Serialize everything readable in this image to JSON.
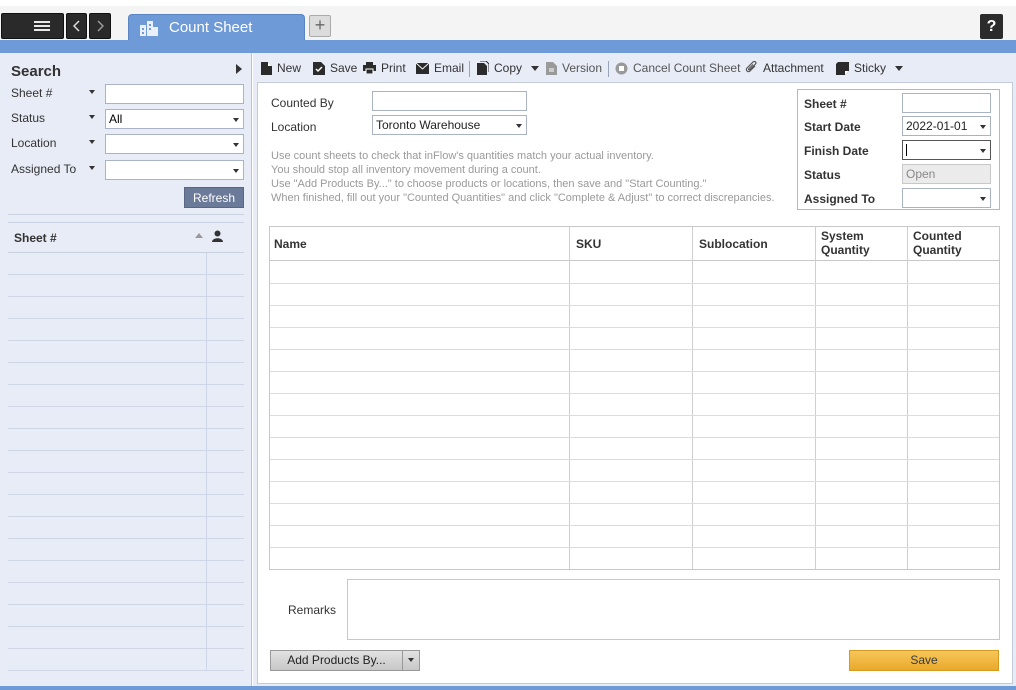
{
  "window": {
    "active_tab": "Count Sheet",
    "add_tab": "+",
    "help": "?"
  },
  "sidebar": {
    "title": "Search",
    "filters": [
      {
        "label": "Sheet #",
        "value": ""
      },
      {
        "label": "Status",
        "value": "All"
      },
      {
        "label": "Location",
        "value": ""
      },
      {
        "label": "Assigned To",
        "value": ""
      }
    ],
    "refresh_label": "Refresh",
    "list_header": "Sheet #"
  },
  "toolbar": {
    "new": "New",
    "save": "Save",
    "print": "Print",
    "email": "Email",
    "copy": "Copy",
    "version": "Version",
    "cancel": "Cancel Count Sheet",
    "attachment": "Attachment",
    "sticky": "Sticky"
  },
  "form": {
    "counted_by_label": "Counted By",
    "counted_by_value": "",
    "location_label": "Location",
    "location_value": "Toronto Warehouse",
    "hint_lines": [
      "Use count sheets to check that inFlow's quantities match your actual inventory.",
      "You should stop all inventory movement during a count.",
      "Use \"Add Products By...\" to choose products or locations, then save and \"Start Counting.\"",
      "When finished, fill out your \"Counted Quantities\" and click \"Complete & Adjust\" to correct discrepancies."
    ]
  },
  "info": {
    "sheet_label": "Sheet #",
    "sheet_value": "",
    "start_label": "Start Date",
    "start_value": "2022-01-01",
    "finish_label": "Finish Date",
    "finish_value": "",
    "status_label": "Status",
    "status_value": "Open",
    "assigned_label": "Assigned To",
    "assigned_value": ""
  },
  "grid": {
    "columns": [
      "Name",
      "SKU",
      "Sublocation",
      "System\nQuantity",
      "Counted\nQuantity"
    ],
    "col_system_1": "System",
    "col_system_2": "Quantity",
    "col_counted_1": "Counted",
    "col_counted_2": "Quantity"
  },
  "footer": {
    "remarks_label": "Remarks",
    "remarks_value": "",
    "add_products_label": "Add Products By...",
    "save_label": "Save"
  }
}
